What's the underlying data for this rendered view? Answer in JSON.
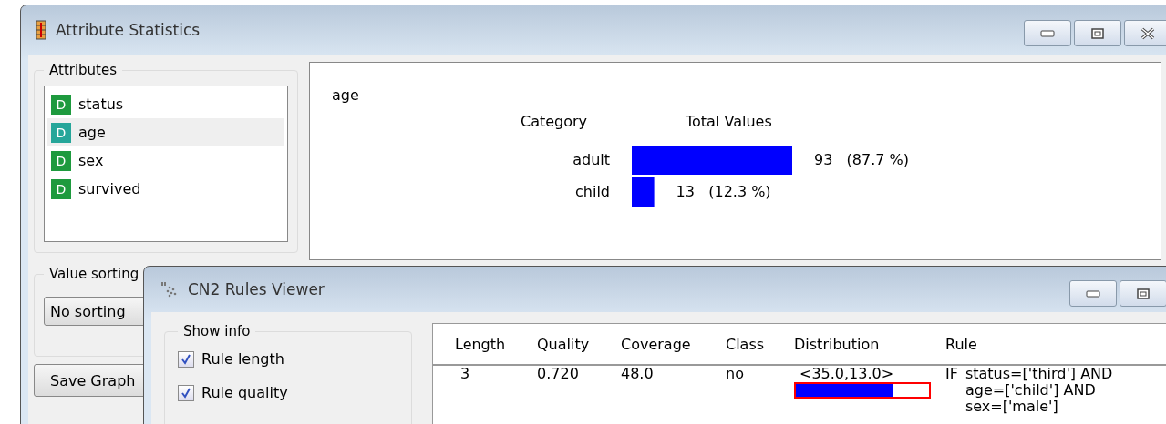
{
  "main_window": {
    "title": "Attribute Statistics",
    "attributes": {
      "title": "Attributes",
      "items": [
        {
          "type_label": "D",
          "name": "status",
          "selected": false
        },
        {
          "type_label": "D",
          "name": "age",
          "selected": true
        },
        {
          "type_label": "D",
          "name": "sex",
          "selected": false
        },
        {
          "type_label": "D",
          "name": "survived",
          "selected": false
        }
      ]
    },
    "value_sorting": {
      "title": "Value sorting",
      "value": "No sorting"
    },
    "save_button": "Save Graph",
    "plot": {
      "attribute": "age",
      "column_headers": [
        "Category",
        "Total Values"
      ],
      "chart_data": {
        "type": "bar",
        "orientation": "horizontal",
        "categories": [
          "adult",
          "child"
        ],
        "values": [
          93,
          13
        ],
        "value_labels": [
          "93   (87.7 %)",
          "13   (12.3 %)"
        ]
      }
    }
  },
  "rules_window": {
    "title": "CN2 Rules Viewer",
    "show_info": {
      "title": "Show info",
      "options": [
        {
          "label": "Rule length",
          "checked": true
        },
        {
          "label": "Rule quality",
          "checked": true
        }
      ]
    },
    "table": {
      "columns": [
        "Length",
        "Quality",
        "Coverage",
        "Class",
        "Distribution",
        "Rule"
      ],
      "rows": [
        {
          "length": "3",
          "quality": "0.720",
          "coverage": "48.0",
          "class": "no",
          "distribution": "<35.0,13.0>",
          "level": 0.729,
          "rule_keyword": "IF",
          "rule_lines": [
            "status=['third'] AND",
            "age=['child'] AND",
            "sex=['male']"
          ]
        }
      ]
    }
  }
}
